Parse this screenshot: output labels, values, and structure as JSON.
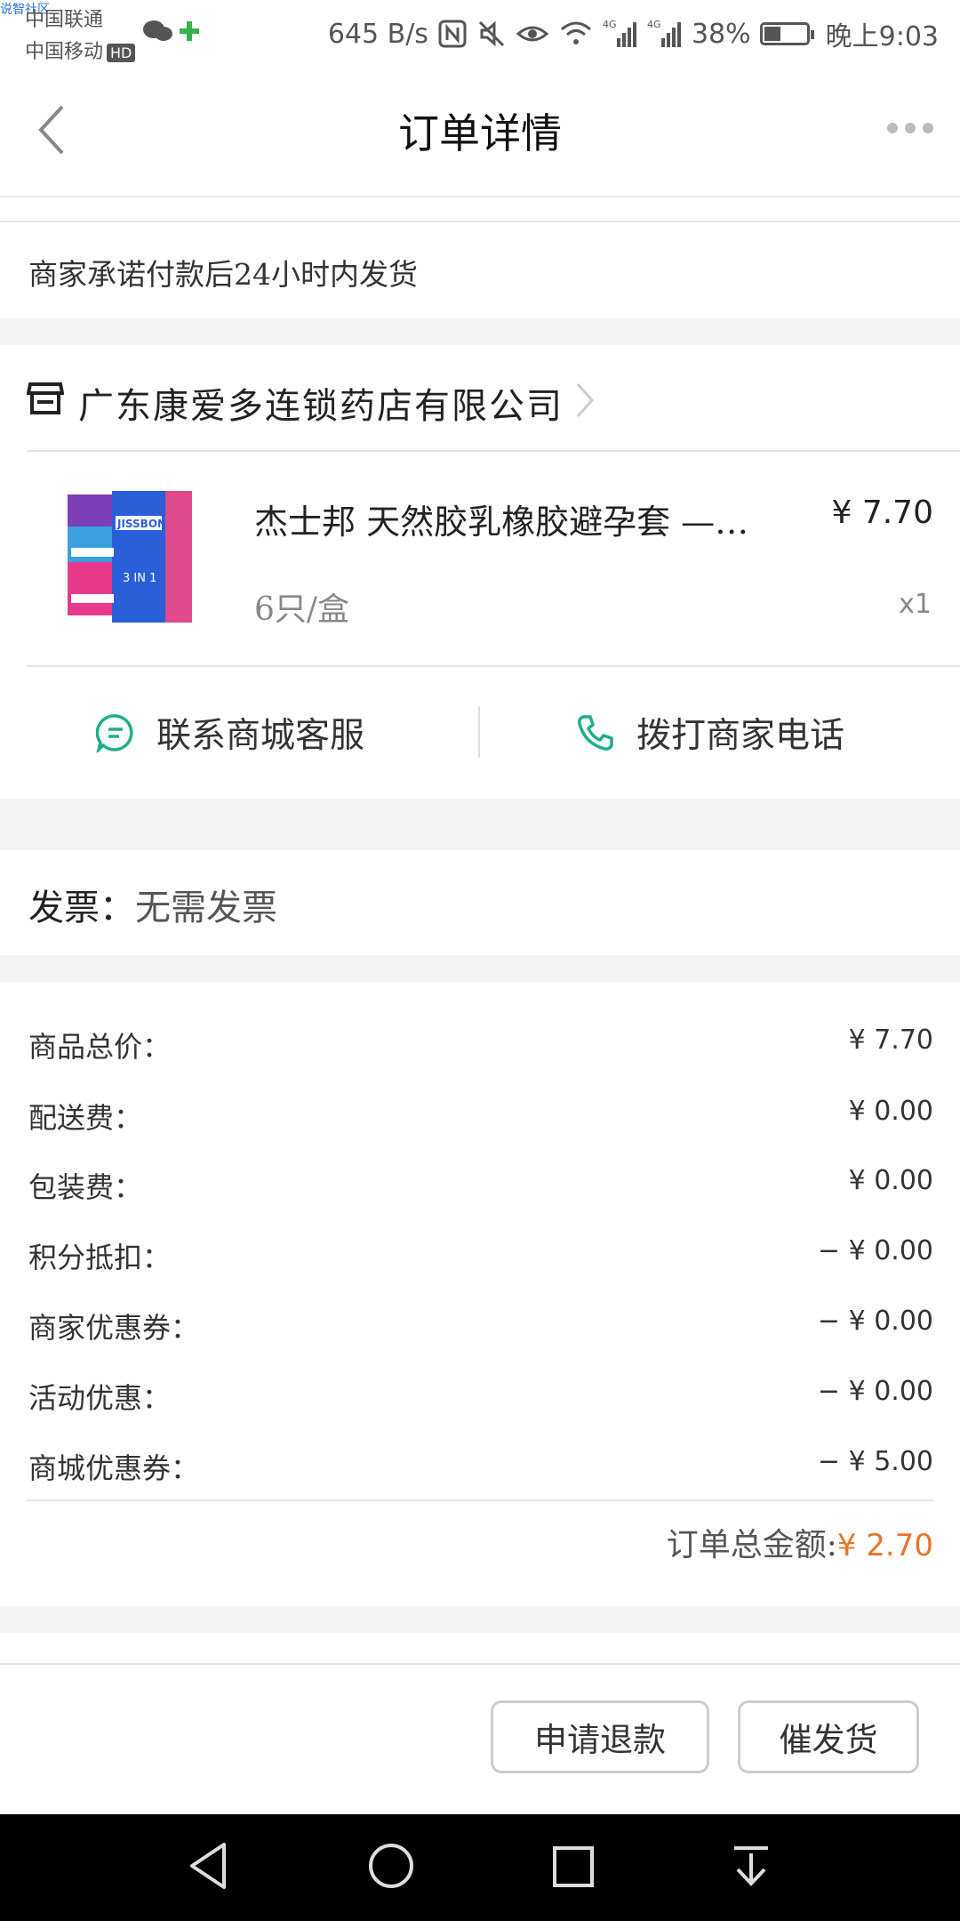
{
  "status_bar": {
    "watermark": "说智社区",
    "carrier1": "中国联通",
    "carrier2": "中国移动",
    "hd": "HD",
    "speed": "645 B/s",
    "battery": "38%",
    "time": "晚上9:03"
  },
  "nav": {
    "title": "订单详情"
  },
  "promise": "商家承诺付款后24小时内发货",
  "store": {
    "name": "广东康爱多连锁药店有限公司"
  },
  "product": {
    "name": "杰士邦 天然胶乳橡胶避孕套 —…",
    "price": "¥ 7.70",
    "spec": "6只/盒",
    "qty": "x1",
    "box_brand": "JISSBON",
    "box_text": "3 IN 1"
  },
  "contact": {
    "service": "联系商城客服",
    "phone": "拨打商家电话"
  },
  "invoice": {
    "label": "发票：",
    "value": "无需发票"
  },
  "fees": [
    {
      "label": "商品总价：",
      "value": "¥ 7.70"
    },
    {
      "label": "配送费：",
      "value": "¥ 0.00"
    },
    {
      "label": "包装费：",
      "value": "¥ 0.00"
    },
    {
      "label": "积分抵扣：",
      "value": "− ¥ 0.00"
    },
    {
      "label": "商家优惠券：",
      "value": "− ¥ 0.00"
    },
    {
      "label": "活动优惠：",
      "value": "− ¥ 0.00"
    },
    {
      "label": "商城优惠券：",
      "value": "− ¥ 5.00"
    }
  ],
  "total": {
    "label": "订单总金额:",
    "amount": "¥ 2.70"
  },
  "actions": {
    "refund": "申请退款",
    "urge": "催发货"
  },
  "colors": {
    "accent_green": "#1fae8b",
    "price_orange": "#e8742b"
  }
}
